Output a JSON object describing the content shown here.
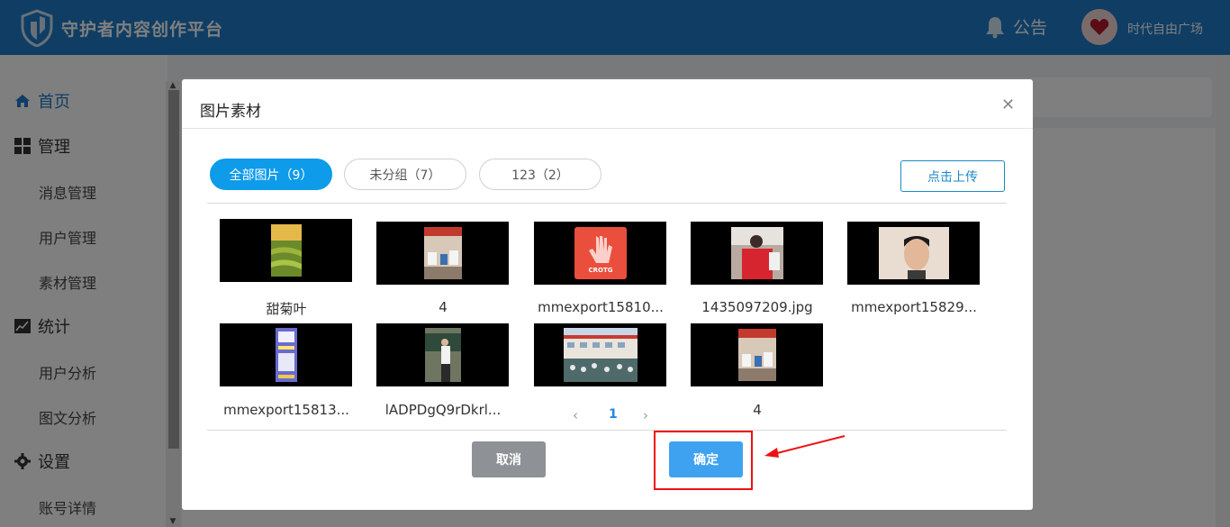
{
  "header": {
    "brand": "守护者内容创作平台",
    "notice_label": "公告",
    "username": "时代自由广场"
  },
  "sidebar": {
    "home": "首页",
    "manage": "管理",
    "manage_items": [
      "消息管理",
      "用户管理",
      "素材管理"
    ],
    "stats": "统计",
    "stats_items": [
      "用户分析",
      "图文分析"
    ],
    "settings": "设置",
    "settings_items": [
      "账号详情"
    ]
  },
  "modal": {
    "title": "图片素材",
    "tabs": [
      "全部图片（9）",
      "未分组（7）",
      "123（2）"
    ],
    "upload_label": "点击上传",
    "images": [
      {
        "caption": "甜菊叶"
      },
      {
        "caption": "4"
      },
      {
        "caption": "mmexport15810..."
      },
      {
        "caption": "1435097209.jpg"
      },
      {
        "caption": "mmexport15829..."
      },
      {
        "caption": "mmexport15813..."
      },
      {
        "caption": "lADPDgQ9rDkrl..."
      },
      {
        "caption": ""
      },
      {
        "caption": "4"
      }
    ],
    "page_prev": "‹",
    "page_current": "1",
    "page_next": "›",
    "cancel_label": "取消",
    "confirm_label": "确定"
  },
  "colors": {
    "header_bg": "#1f7ac9",
    "active_tab": "#0d9bea",
    "confirm": "#3ea2f1",
    "cancel": "#8e9196",
    "highlight": "#ee1111"
  }
}
